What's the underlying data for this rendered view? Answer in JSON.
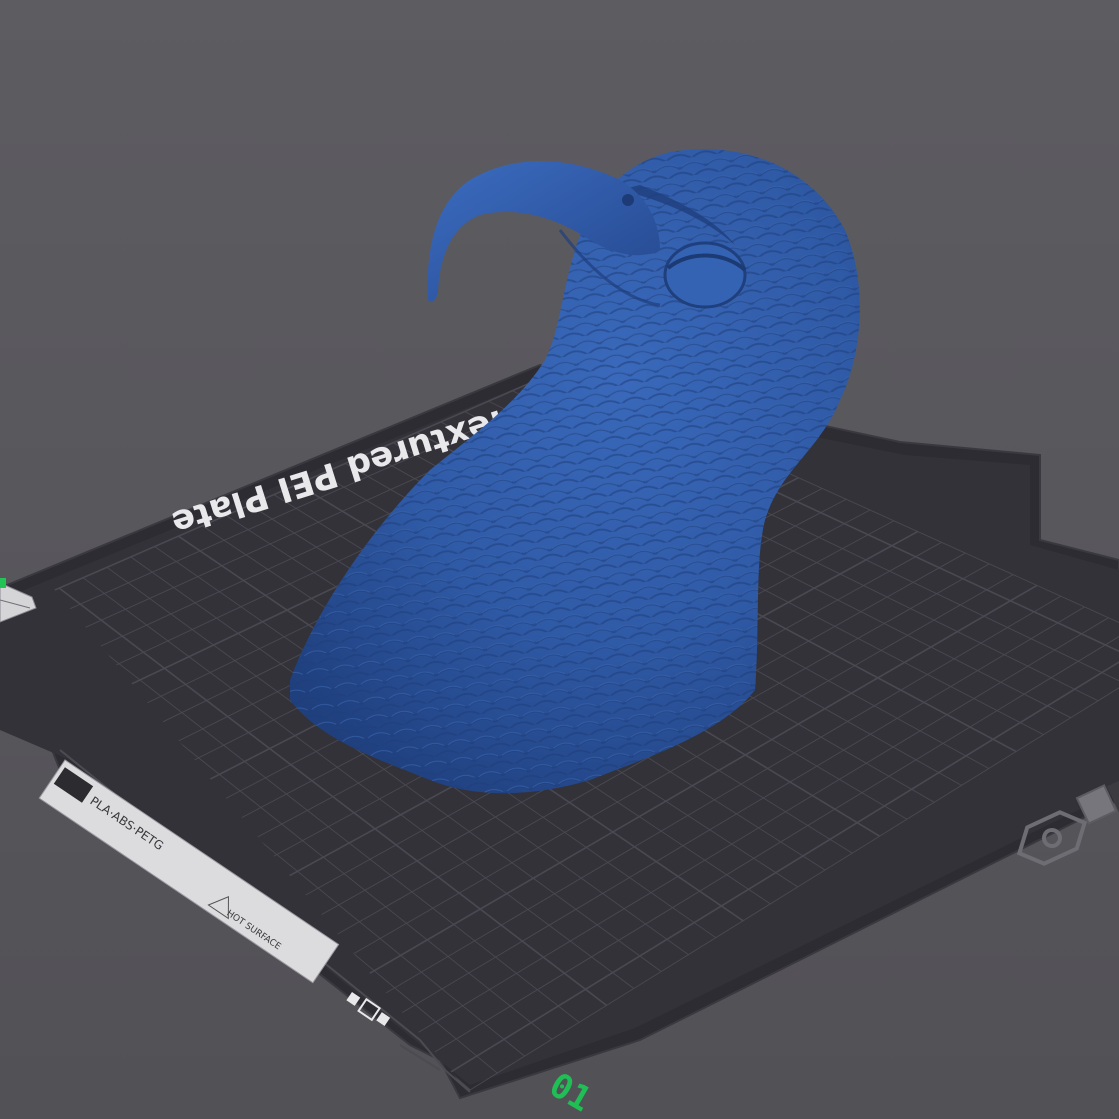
{
  "viewport": {
    "background_color": "#58575c"
  },
  "build_plate": {
    "label": "Textured PEI Plate",
    "sticker_text": "PLA·ABS·PETG",
    "warning_text": "HOT SURFACE",
    "plate_number": "01",
    "plate_color": "#2e2d33",
    "grid_color": "#4a4952",
    "plate_number_color": "#1fbf55"
  },
  "model": {
    "description_icon": "eagle-head-model",
    "color": "#2e5aa6"
  },
  "icons": {
    "right_plate_icon": "gear-hex-icon",
    "left_plate_icon": "plate-corner-icon",
    "top_right_icon": "square-button-icon"
  }
}
